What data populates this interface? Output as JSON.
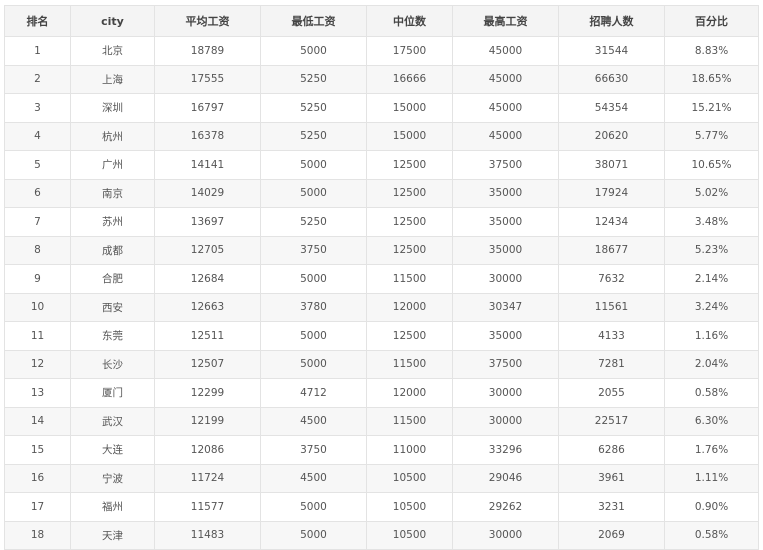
{
  "table": {
    "columns": [
      "排名",
      "city",
      "平均工资",
      "最低工资",
      "中位数",
      "最高工资",
      "招聘人数",
      "百分比"
    ],
    "rows": [
      [
        "1",
        "北京",
        "18789",
        "5000",
        "17500",
        "45000",
        "31544",
        "8.83%"
      ],
      [
        "2",
        "上海",
        "17555",
        "5250",
        "16666",
        "45000",
        "66630",
        "18.65%"
      ],
      [
        "3",
        "深圳",
        "16797",
        "5250",
        "15000",
        "45000",
        "54354",
        "15.21%"
      ],
      [
        "4",
        "杭州",
        "16378",
        "5250",
        "15000",
        "45000",
        "20620",
        "5.77%"
      ],
      [
        "5",
        "广州",
        "14141",
        "5000",
        "12500",
        "37500",
        "38071",
        "10.65%"
      ],
      [
        "6",
        "南京",
        "14029",
        "5000",
        "12500",
        "35000",
        "17924",
        "5.02%"
      ],
      [
        "7",
        "苏州",
        "13697",
        "5250",
        "12500",
        "35000",
        "12434",
        "3.48%"
      ],
      [
        "8",
        "成都",
        "12705",
        "3750",
        "12500",
        "35000",
        "18677",
        "5.23%"
      ],
      [
        "9",
        "合肥",
        "12684",
        "5000",
        "11500",
        "30000",
        "7632",
        "2.14%"
      ],
      [
        "10",
        "西安",
        "12663",
        "3780",
        "12000",
        "30347",
        "11561",
        "3.24%"
      ],
      [
        "11",
        "东莞",
        "12511",
        "5000",
        "12500",
        "35000",
        "4133",
        "1.16%"
      ],
      [
        "12",
        "长沙",
        "12507",
        "5000",
        "11500",
        "37500",
        "7281",
        "2.04%"
      ],
      [
        "13",
        "厦门",
        "12299",
        "4712",
        "12000",
        "30000",
        "2055",
        "0.58%"
      ],
      [
        "14",
        "武汉",
        "12199",
        "4500",
        "11500",
        "30000",
        "22517",
        "6.30%"
      ],
      [
        "15",
        "大连",
        "12086",
        "3750",
        "11000",
        "33296",
        "6286",
        "1.76%"
      ],
      [
        "16",
        "宁波",
        "11724",
        "4500",
        "10500",
        "29046",
        "3961",
        "1.11%"
      ],
      [
        "17",
        "福州",
        "11577",
        "5000",
        "10500",
        "29262",
        "3231",
        "0.90%"
      ],
      [
        "18",
        "天津",
        "11483",
        "5000",
        "10500",
        "30000",
        "2069",
        "0.58%"
      ]
    ]
  }
}
